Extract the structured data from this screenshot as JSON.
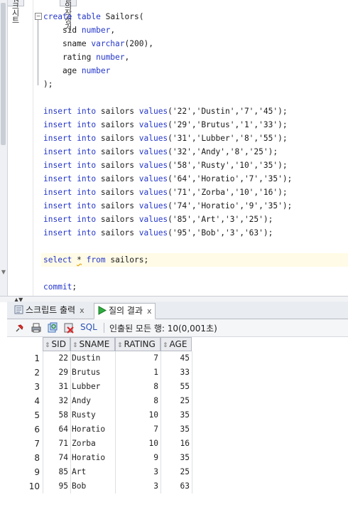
{
  "top_tabs": [
    "워크시트",
    "질의 작성기"
  ],
  "code_lines": [
    [
      [
        "kw",
        "create"
      ],
      [
        "t",
        " "
      ],
      [
        "kw",
        "table"
      ],
      [
        "t",
        " Sailors("
      ]
    ],
    [
      [
        "t",
        "    sid "
      ],
      [
        "kw",
        "number"
      ],
      [
        "t",
        ","
      ]
    ],
    [
      [
        "t",
        "    sname "
      ],
      [
        "kw",
        "varchar"
      ],
      [
        "t",
        "(200),"
      ]
    ],
    [
      [
        "t",
        "    rating "
      ],
      [
        "kw",
        "number"
      ],
      [
        "t",
        ","
      ]
    ],
    [
      [
        "t",
        "    age "
      ],
      [
        "kw",
        "number"
      ]
    ],
    [
      [
        "t",
        ");"
      ]
    ],
    [
      [
        "t",
        ""
      ]
    ],
    [
      [
        "kw",
        "insert"
      ],
      [
        "t",
        " "
      ],
      [
        "kw",
        "into"
      ],
      [
        "t",
        " sailors "
      ],
      [
        "kw",
        "values"
      ],
      [
        "t",
        "('22','Dustin','7','45');"
      ]
    ],
    [
      [
        "kw",
        "insert"
      ],
      [
        "t",
        " "
      ],
      [
        "kw",
        "into"
      ],
      [
        "t",
        " sailors "
      ],
      [
        "kw",
        "values"
      ],
      [
        "t",
        "('29','Brutus','1','33');"
      ]
    ],
    [
      [
        "kw",
        "insert"
      ],
      [
        "t",
        " "
      ],
      [
        "kw",
        "into"
      ],
      [
        "t",
        " sailors "
      ],
      [
        "kw",
        "values"
      ],
      [
        "t",
        "('31','Lubber','8','55');"
      ]
    ],
    [
      [
        "kw",
        "insert"
      ],
      [
        "t",
        " "
      ],
      [
        "kw",
        "into"
      ],
      [
        "t",
        " sailors "
      ],
      [
        "kw",
        "values"
      ],
      [
        "t",
        "('32','Andy','8','25');"
      ]
    ],
    [
      [
        "kw",
        "insert"
      ],
      [
        "t",
        " "
      ],
      [
        "kw",
        "into"
      ],
      [
        "t",
        " sailors "
      ],
      [
        "kw",
        "values"
      ],
      [
        "t",
        "('58','Rusty','10','35');"
      ]
    ],
    [
      [
        "kw",
        "insert"
      ],
      [
        "t",
        " "
      ],
      [
        "kw",
        "into"
      ],
      [
        "t",
        " sailors "
      ],
      [
        "kw",
        "values"
      ],
      [
        "t",
        "('64','Horatio','7','35');"
      ]
    ],
    [
      [
        "kw",
        "insert"
      ],
      [
        "t",
        " "
      ],
      [
        "kw",
        "into"
      ],
      [
        "t",
        " sailors "
      ],
      [
        "kw",
        "values"
      ],
      [
        "t",
        "('71','Zorba','10','16');"
      ]
    ],
    [
      [
        "kw",
        "insert"
      ],
      [
        "t",
        " "
      ],
      [
        "kw",
        "into"
      ],
      [
        "t",
        " sailors "
      ],
      [
        "kw",
        "values"
      ],
      [
        "t",
        "('74','Horatio','9','35');"
      ]
    ],
    [
      [
        "kw",
        "insert"
      ],
      [
        "t",
        " "
      ],
      [
        "kw",
        "into"
      ],
      [
        "t",
        " sailors "
      ],
      [
        "kw",
        "values"
      ],
      [
        "t",
        "('85','Art','3','25');"
      ]
    ],
    [
      [
        "kw",
        "insert"
      ],
      [
        "t",
        " "
      ],
      [
        "kw",
        "into"
      ],
      [
        "t",
        " sailors "
      ],
      [
        "kw",
        "values"
      ],
      [
        "t",
        "('95','Bob','3','63');"
      ]
    ],
    [
      [
        "t",
        ""
      ]
    ],
    [
      [
        "kw",
        "select"
      ],
      [
        "t",
        " "
      ],
      [
        "sq",
        "*"
      ],
      [
        "t",
        " "
      ],
      [
        "kw",
        "from"
      ],
      [
        "t",
        " sailors;"
      ]
    ],
    [
      [
        "t",
        ""
      ]
    ],
    [
      [
        "kw",
        "commit"
      ],
      [
        "t",
        ";"
      ]
    ]
  ],
  "results_tabs": {
    "script_output": "스크립트 출력",
    "query_result": "질의 결과"
  },
  "toolbar": {
    "sql_label": "SQL",
    "status": "인출된 모든 행: 10(0,001초)"
  },
  "grid": {
    "columns": [
      "SID",
      "SNAME",
      "RATING",
      "AGE"
    ],
    "rows": [
      [
        "1",
        "22",
        "Dustin",
        "7",
        "45"
      ],
      [
        "2",
        "29",
        "Brutus",
        "1",
        "33"
      ],
      [
        "3",
        "31",
        "Lubber",
        "8",
        "55"
      ],
      [
        "4",
        "32",
        "Andy",
        "8",
        "25"
      ],
      [
        "5",
        "58",
        "Rusty",
        "10",
        "35"
      ],
      [
        "6",
        "64",
        "Horatio",
        "7",
        "35"
      ],
      [
        "7",
        "71",
        "Zorba",
        "10",
        "16"
      ],
      [
        "8",
        "74",
        "Horatio",
        "9",
        "35"
      ],
      [
        "9",
        "85",
        "Art",
        "3",
        "25"
      ],
      [
        "10",
        "95",
        "Bob",
        "3",
        "63"
      ]
    ]
  },
  "colors": {
    "keyword": "#2537c9",
    "current_line": "#fffbe6",
    "sql_link": "#2b54b5"
  }
}
